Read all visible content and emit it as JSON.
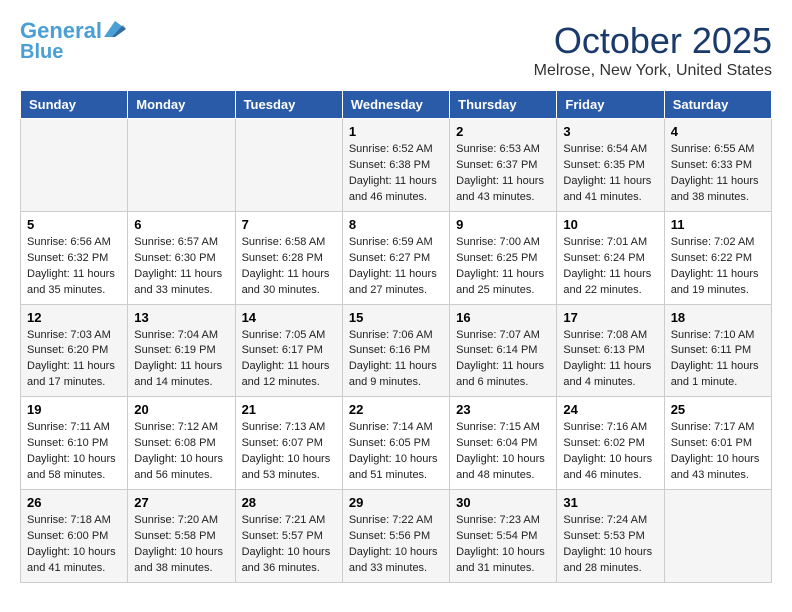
{
  "header": {
    "logo_line1": "General",
    "logo_line2": "Blue",
    "month_title": "October 2025",
    "location": "Melrose, New York, United States"
  },
  "weekdays": [
    "Sunday",
    "Monday",
    "Tuesday",
    "Wednesday",
    "Thursday",
    "Friday",
    "Saturday"
  ],
  "weeks": [
    [
      {
        "day": "",
        "info": ""
      },
      {
        "day": "",
        "info": ""
      },
      {
        "day": "",
        "info": ""
      },
      {
        "day": "1",
        "info": "Sunrise: 6:52 AM\nSunset: 6:38 PM\nDaylight: 11 hours and 46 minutes."
      },
      {
        "day": "2",
        "info": "Sunrise: 6:53 AM\nSunset: 6:37 PM\nDaylight: 11 hours and 43 minutes."
      },
      {
        "day": "3",
        "info": "Sunrise: 6:54 AM\nSunset: 6:35 PM\nDaylight: 11 hours and 41 minutes."
      },
      {
        "day": "4",
        "info": "Sunrise: 6:55 AM\nSunset: 6:33 PM\nDaylight: 11 hours and 38 minutes."
      }
    ],
    [
      {
        "day": "5",
        "info": "Sunrise: 6:56 AM\nSunset: 6:32 PM\nDaylight: 11 hours and 35 minutes."
      },
      {
        "day": "6",
        "info": "Sunrise: 6:57 AM\nSunset: 6:30 PM\nDaylight: 11 hours and 33 minutes."
      },
      {
        "day": "7",
        "info": "Sunrise: 6:58 AM\nSunset: 6:28 PM\nDaylight: 11 hours and 30 minutes."
      },
      {
        "day": "8",
        "info": "Sunrise: 6:59 AM\nSunset: 6:27 PM\nDaylight: 11 hours and 27 minutes."
      },
      {
        "day": "9",
        "info": "Sunrise: 7:00 AM\nSunset: 6:25 PM\nDaylight: 11 hours and 25 minutes."
      },
      {
        "day": "10",
        "info": "Sunrise: 7:01 AM\nSunset: 6:24 PM\nDaylight: 11 hours and 22 minutes."
      },
      {
        "day": "11",
        "info": "Sunrise: 7:02 AM\nSunset: 6:22 PM\nDaylight: 11 hours and 19 minutes."
      }
    ],
    [
      {
        "day": "12",
        "info": "Sunrise: 7:03 AM\nSunset: 6:20 PM\nDaylight: 11 hours and 17 minutes."
      },
      {
        "day": "13",
        "info": "Sunrise: 7:04 AM\nSunset: 6:19 PM\nDaylight: 11 hours and 14 minutes."
      },
      {
        "day": "14",
        "info": "Sunrise: 7:05 AM\nSunset: 6:17 PM\nDaylight: 11 hours and 12 minutes."
      },
      {
        "day": "15",
        "info": "Sunrise: 7:06 AM\nSunset: 6:16 PM\nDaylight: 11 hours and 9 minutes."
      },
      {
        "day": "16",
        "info": "Sunrise: 7:07 AM\nSunset: 6:14 PM\nDaylight: 11 hours and 6 minutes."
      },
      {
        "day": "17",
        "info": "Sunrise: 7:08 AM\nSunset: 6:13 PM\nDaylight: 11 hours and 4 minutes."
      },
      {
        "day": "18",
        "info": "Sunrise: 7:10 AM\nSunset: 6:11 PM\nDaylight: 11 hours and 1 minute."
      }
    ],
    [
      {
        "day": "19",
        "info": "Sunrise: 7:11 AM\nSunset: 6:10 PM\nDaylight: 10 hours and 58 minutes."
      },
      {
        "day": "20",
        "info": "Sunrise: 7:12 AM\nSunset: 6:08 PM\nDaylight: 10 hours and 56 minutes."
      },
      {
        "day": "21",
        "info": "Sunrise: 7:13 AM\nSunset: 6:07 PM\nDaylight: 10 hours and 53 minutes."
      },
      {
        "day": "22",
        "info": "Sunrise: 7:14 AM\nSunset: 6:05 PM\nDaylight: 10 hours and 51 minutes."
      },
      {
        "day": "23",
        "info": "Sunrise: 7:15 AM\nSunset: 6:04 PM\nDaylight: 10 hours and 48 minutes."
      },
      {
        "day": "24",
        "info": "Sunrise: 7:16 AM\nSunset: 6:02 PM\nDaylight: 10 hours and 46 minutes."
      },
      {
        "day": "25",
        "info": "Sunrise: 7:17 AM\nSunset: 6:01 PM\nDaylight: 10 hours and 43 minutes."
      }
    ],
    [
      {
        "day": "26",
        "info": "Sunrise: 7:18 AM\nSunset: 6:00 PM\nDaylight: 10 hours and 41 minutes."
      },
      {
        "day": "27",
        "info": "Sunrise: 7:20 AM\nSunset: 5:58 PM\nDaylight: 10 hours and 38 minutes."
      },
      {
        "day": "28",
        "info": "Sunrise: 7:21 AM\nSunset: 5:57 PM\nDaylight: 10 hours and 36 minutes."
      },
      {
        "day": "29",
        "info": "Sunrise: 7:22 AM\nSunset: 5:56 PM\nDaylight: 10 hours and 33 minutes."
      },
      {
        "day": "30",
        "info": "Sunrise: 7:23 AM\nSunset: 5:54 PM\nDaylight: 10 hours and 31 minutes."
      },
      {
        "day": "31",
        "info": "Sunrise: 7:24 AM\nSunset: 5:53 PM\nDaylight: 10 hours and 28 minutes."
      },
      {
        "day": "",
        "info": ""
      }
    ]
  ]
}
